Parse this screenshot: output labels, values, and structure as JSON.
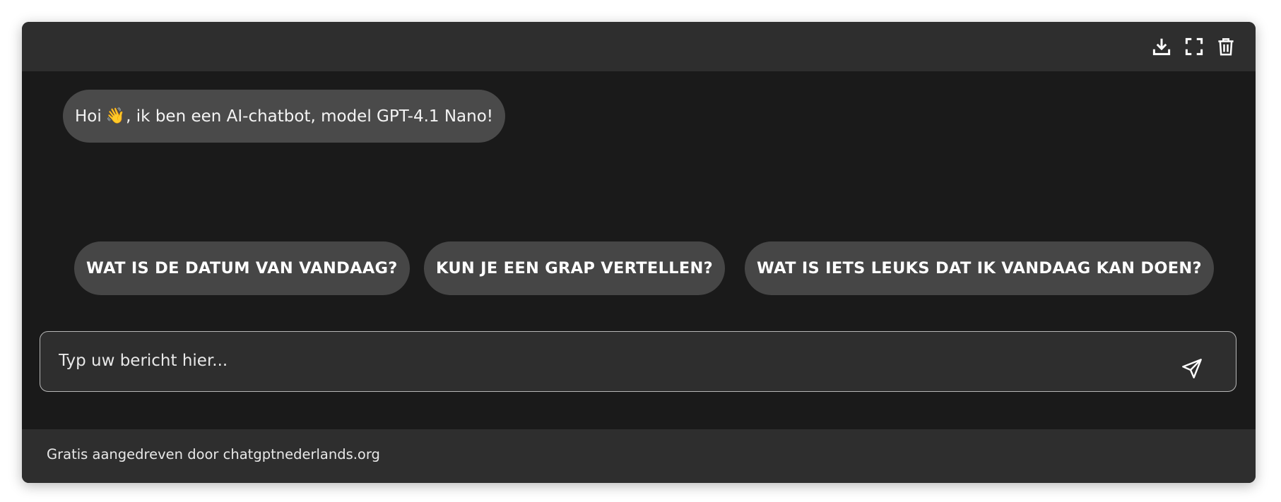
{
  "toolbar": {
    "icons": [
      "download-icon",
      "fullscreen-icon",
      "trash-icon"
    ]
  },
  "chat": {
    "greeting_prefix": "Hoi",
    "greeting_emoji": "👋",
    "greeting_suffix": ", ik ben een AI-chatbot, model GPT-4.1 Nano!"
  },
  "suggestions": [
    "WAT IS DE DATUM VAN VANDAAG?",
    "KUN JE EEN GRAP VERTELLEN?",
    "WAT IS IETS LEUKS DAT IK VANDAAG KAN DOEN?"
  ],
  "input": {
    "placeholder": "Typ uw bericht hier...",
    "value": ""
  },
  "footer": {
    "text": "Gratis aangedreven door chatgptnederlands.org"
  },
  "colors": {
    "panel": "#1a1a1a",
    "bar": "#2e2e2e",
    "bubble": "#4a4a4a",
    "suggestion": "#464646",
    "text": "#f4f4f4"
  }
}
